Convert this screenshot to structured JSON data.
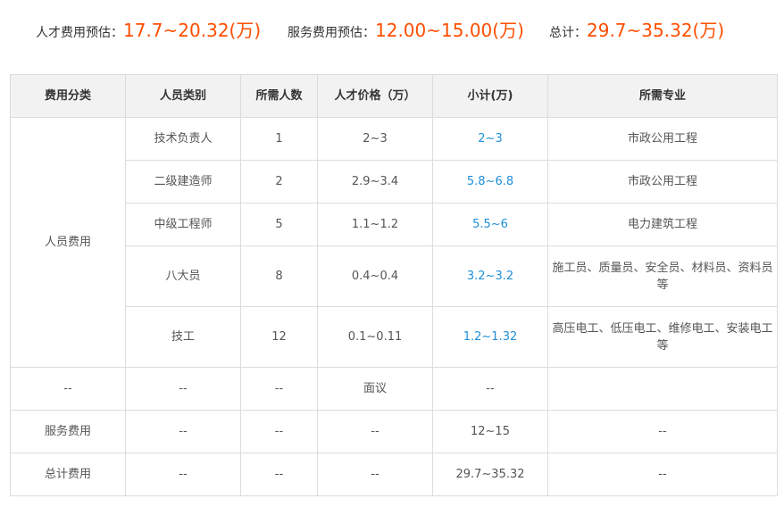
{
  "summary": {
    "talent_label": "人才费用预估：",
    "talent_value": "17.7~20.32(万)",
    "service_label": "服务费用预估：",
    "service_value": "12.00~15.00(万)",
    "total_label": "总计：",
    "total_value": "29.7~35.32(万)",
    "accent_color": "#ff4e00"
  },
  "table": {
    "headers": [
      "费用分类",
      "人员类别",
      "所需人数",
      "人才价格（万）",
      "小计(万)",
      "所需专业"
    ],
    "personnel_category": "人员费用",
    "personnel_rows": [
      {
        "role": "技术负责人",
        "count": "1",
        "price": "2~3",
        "subtotal": "2~3",
        "major": "市政公用工程"
      },
      {
        "role": "二级建造师",
        "count": "2",
        "price": "2.9~3.4",
        "subtotal": "5.8~6.8",
        "major": "市政公用工程"
      },
      {
        "role": "中级工程师",
        "count": "5",
        "price": "1.1~1.2",
        "subtotal": "5.5~6",
        "major": "电力建筑工程"
      },
      {
        "role": "八大员",
        "count": "8",
        "price": "0.4~0.4",
        "subtotal": "3.2~3.2",
        "major": "施工员、质量员、安全员、材料员、资料员等"
      },
      {
        "role": "技工",
        "count": "12",
        "price": "0.1~0.11",
        "subtotal": "1.2~1.32",
        "major": "高压电工、低压电工、维修电工、安装电工等"
      }
    ],
    "other_row": {
      "category": "--",
      "role": "--",
      "count": "--",
      "price": "面议",
      "subtotal": "--",
      "major": ""
    },
    "service_row": {
      "category": "服务费用",
      "role": "--",
      "count": "--",
      "price": "--",
      "subtotal": "12~15",
      "major": "--"
    },
    "total_row": {
      "category": "总计费用",
      "role": "--",
      "count": "--",
      "price": "--",
      "subtotal": "29.7~35.32",
      "major": "--"
    },
    "subtotal_color": "#1e8fd7"
  }
}
